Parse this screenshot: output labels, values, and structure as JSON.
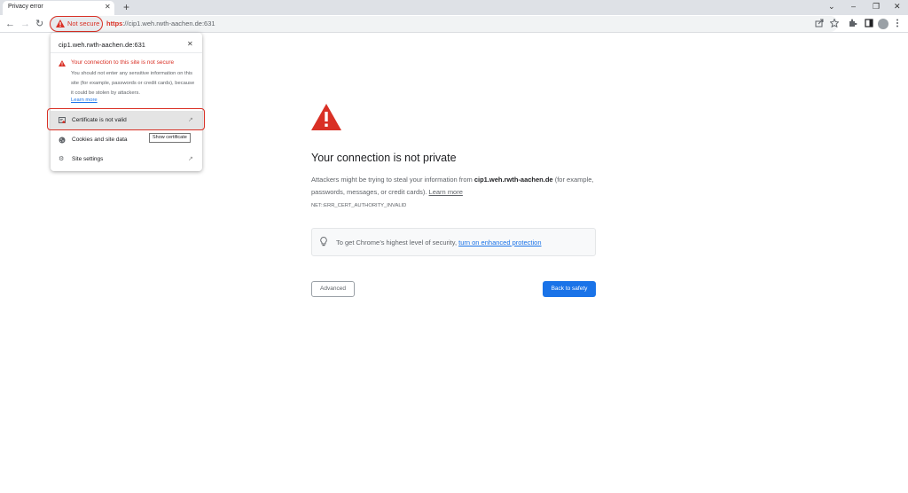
{
  "browser": {
    "tab_title": "Privacy error",
    "tab_close": "✕",
    "new_tab": "+",
    "window": {
      "chevron": "⌄",
      "minimize": "–",
      "restore": "❐",
      "close": "✕"
    },
    "nav": {
      "back": "←",
      "forward": "→",
      "reload": "↻"
    },
    "omnibox": {
      "chip_label": "Not secure",
      "url_scheme": "https",
      "url_rest": "://cip1.weh.rwth-aachen.de:631"
    },
    "toolbar_icons": [
      "share-icon",
      "star-icon",
      "extensions-icon",
      "side-panel-icon",
      "profile-icon",
      "menu-icon"
    ]
  },
  "site_info_popup": {
    "host": "cip1.weh.rwth-aachen.de:631",
    "close": "✕",
    "warning_title": "Your connection to this site is not secure",
    "warning_body": "You should not enter any sensitive information on this site (for example, passwords or credit cards), because it could be stolen by attackers.",
    "learn_more": "Learn more",
    "items": [
      {
        "label": "Certificate is not valid",
        "icon": "certificate-icon",
        "external": true
      },
      {
        "label": "Cookies and site data",
        "icon": "cookie-icon",
        "external": false
      },
      {
        "label": "Site settings",
        "icon": "gear-icon",
        "external": true
      }
    ],
    "tooltip": "Show certificate"
  },
  "interstitial": {
    "heading": "Your connection is not private",
    "desc_prefix": "Attackers might be trying to steal your information from ",
    "desc_host": "cip1.weh.rwth-aachen.de",
    "desc_suffix": " (for example, passwords, messages, or credit cards). ",
    "desc_link": "Learn more",
    "error_code": "NET::ERR_CERT_AUTHORITY_INVALID",
    "enhanced_text": "To get Chrome’s highest level of security, ",
    "enhanced_link": "turn on enhanced protection",
    "advanced_button": "Advanced",
    "safety_button": "Back to safety"
  },
  "colors": {
    "danger": "#d93025",
    "accent": "#1a73e8",
    "text_secondary": "#5f6368"
  }
}
